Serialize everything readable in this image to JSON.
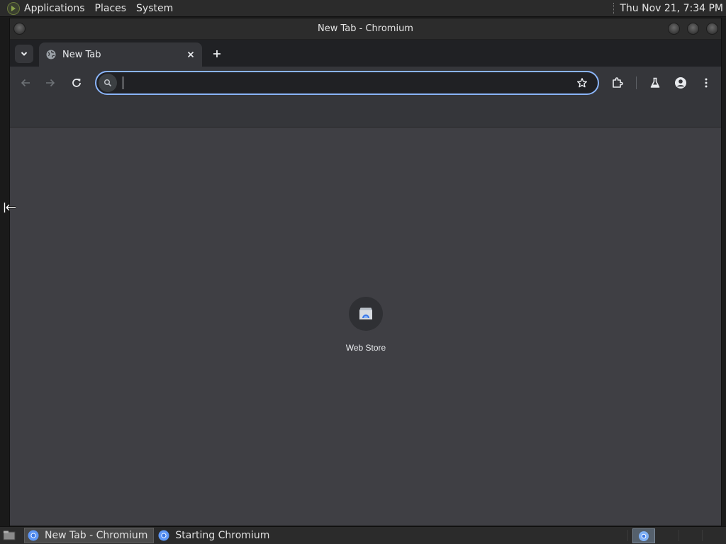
{
  "top_panel": {
    "menus": [
      "Applications",
      "Places",
      "System"
    ],
    "clock": "Thu Nov 21,  7:34 PM"
  },
  "window": {
    "title": "New Tab - Chromium"
  },
  "tabs": [
    {
      "label": "New Tab",
      "favicon": "globe-icon"
    }
  ],
  "toolbar": {
    "omnibox_value": "",
    "icons": [
      "back-arrow-icon",
      "forward-arrow-icon",
      "reload-icon",
      "search-icon",
      "bookmark-star-icon",
      "extensions-icon",
      "labs-flask-icon",
      "profile-icon",
      "menu-kebab-icon"
    ]
  },
  "new_tab_page": {
    "shortcuts": [
      {
        "label": "Web Store",
        "icon": "web-store-icon"
      }
    ]
  },
  "taskbar": {
    "tasks": [
      {
        "label": "New Tab - Chromium",
        "active": true
      },
      {
        "label": "Starting Chromium",
        "active": false
      }
    ]
  },
  "colors": {
    "omnibox_focus": "#8ab4f8",
    "content_bg": "#3f3f44",
    "toolbar_bg": "#35363a"
  }
}
